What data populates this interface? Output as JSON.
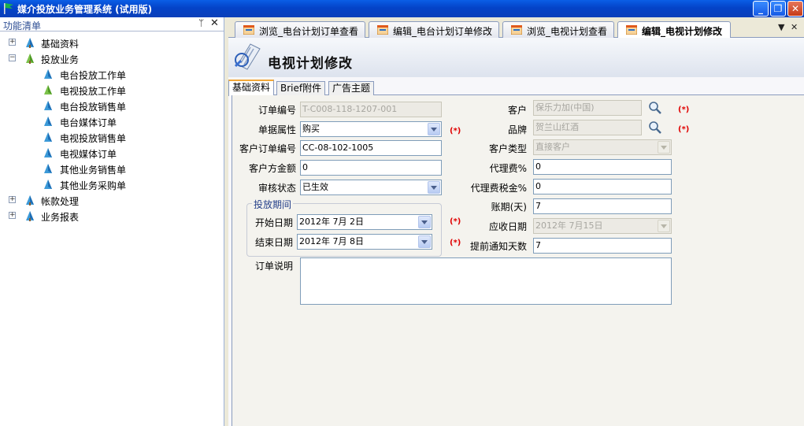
{
  "window": {
    "title": "媒介投放业务管理系统 (试用版)",
    "min": "_",
    "max": "❐",
    "close": "✕"
  },
  "sidebar": {
    "header": "功能清单",
    "pin": "ᛘ",
    "close": "✕",
    "items": [
      {
        "label": "基础资料",
        "expander": "+"
      },
      {
        "label": "投放业务",
        "expander": "−"
      },
      {
        "label": "电台投放工作单"
      },
      {
        "label": "电视投放工作单"
      },
      {
        "label": "电台投放销售单"
      },
      {
        "label": "电台媒体订单"
      },
      {
        "label": "电视投放销售单"
      },
      {
        "label": "电视媒体订单"
      },
      {
        "label": "其他业务销售单"
      },
      {
        "label": "其他业务采购单"
      },
      {
        "label": "帐款处理",
        "expander": "+"
      },
      {
        "label": "业务报表",
        "expander": "+"
      }
    ]
  },
  "doc_tabs": [
    {
      "label": "浏览_电台计划订单查看"
    },
    {
      "label": "编辑_电台计划订单修改"
    },
    {
      "label": "浏览_电视计划查看"
    },
    {
      "label": "编辑_电视计划修改"
    }
  ],
  "tabstrip_buttons": {
    "menu": "▼",
    "close": "✕"
  },
  "form": {
    "title": "电视计划修改",
    "subtabs": [
      "基础资料",
      "Brief附件",
      "广告主题"
    ],
    "fields": {
      "order_no": {
        "label": "订单编号",
        "value": "T-C008-118-1207-001"
      },
      "doc_attr": {
        "label": "单据属性",
        "value": "购买"
      },
      "client_order_no": {
        "label": "客户订单编号",
        "value": "CC-08-102-1005"
      },
      "client_amount": {
        "label": "客户方金额",
        "value": "0"
      },
      "audit_status": {
        "label": "审核状态",
        "value": "已生效"
      },
      "period_group": {
        "label": "投放期间"
      },
      "start_date": {
        "label": "开始日期",
        "value": "2012年 7月 2日"
      },
      "end_date": {
        "label": "结束日期",
        "value": "2012年 7月 8日"
      },
      "customer": {
        "label": "客户",
        "value": "保乐力加(中国)"
      },
      "brand": {
        "label": "品牌",
        "value": "贺兰山红酒"
      },
      "customer_type": {
        "label": "客户类型",
        "value": "直接客户"
      },
      "agency_fee": {
        "label": "代理费%",
        "value": "0"
      },
      "agency_tax": {
        "label": "代理费税金%",
        "value": "0"
      },
      "account_period": {
        "label": "账期(天)",
        "value": "7"
      },
      "due_date": {
        "label": "应收日期",
        "value": "2012年 7月15日"
      },
      "notice_days": {
        "label": "提前通知天数",
        "value": "7"
      },
      "remarks": {
        "label": "订单说明",
        "value": ""
      }
    },
    "required_mark": "(*)"
  },
  "colors": {
    "titlebar": "#0a5ee6",
    "required": "#e00000",
    "active_tab_accent": "#f2a838"
  }
}
